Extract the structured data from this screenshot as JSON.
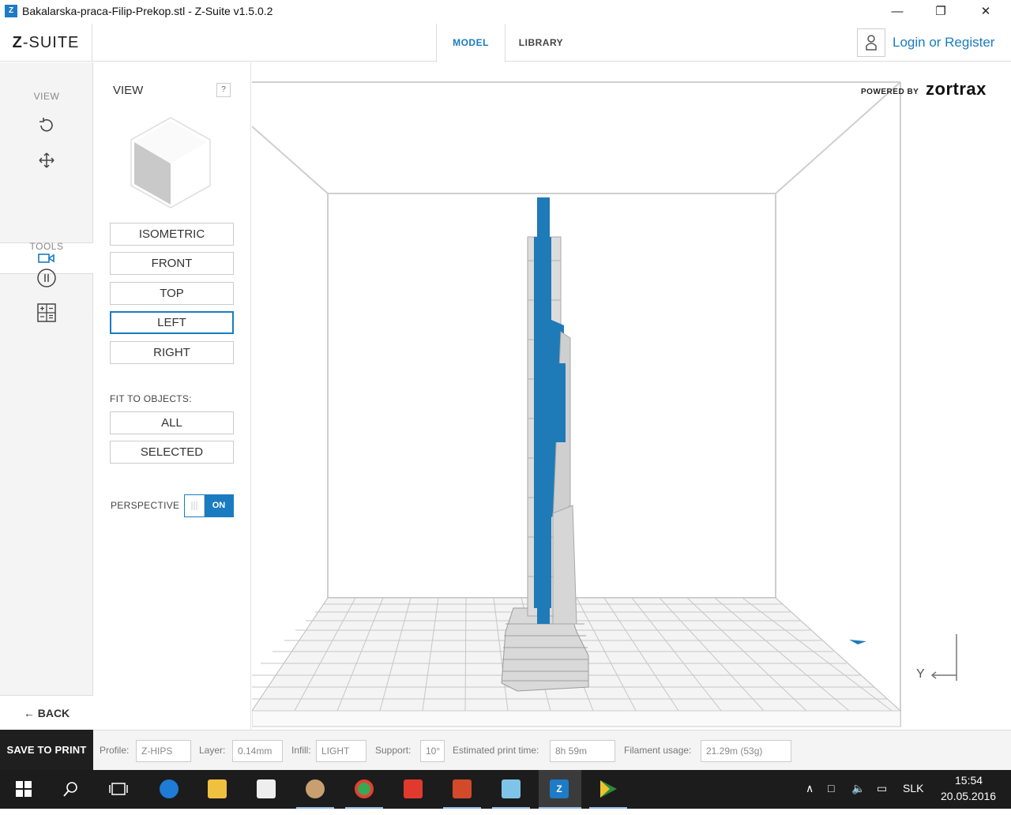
{
  "window": {
    "title": "Bakalarska-praca-Filip-Prekop.stl - Z-Suite v1.5.0.2",
    "icon_letter": "Z"
  },
  "header": {
    "logo_bold": "Z",
    "logo_rest": "-SUITE",
    "tabs": [
      {
        "label": "MODEL",
        "active": true
      },
      {
        "label": "LIBRARY",
        "active": false
      }
    ],
    "login": "Login or Register"
  },
  "sidebar": {
    "view_label": "VIEW",
    "tools_label": "TOOLS",
    "back": "BACK"
  },
  "view_panel": {
    "title": "VIEW",
    "help": "?",
    "buttons": [
      "ISOMETRIC",
      "FRONT",
      "TOP",
      "LEFT",
      "RIGHT"
    ],
    "active_button": "LEFT",
    "fit_label": "FIT TO OBJECTS:",
    "fit_buttons": [
      "ALL",
      "SELECTED"
    ],
    "perspective_label": "PERSPECTIVE",
    "perspective_state": "ON"
  },
  "viewport": {
    "powered_by": "POWERED BY",
    "brand": "zortrax",
    "axis_label": "Y"
  },
  "bottom": {
    "save": "SAVE TO PRINT",
    "profile_label": "Profile:",
    "profile": "Z-HIPS",
    "layer_label": "Layer:",
    "layer": "0.14mm",
    "infill_label": "Infill:",
    "infill": "LIGHT",
    "support_label": "Support:",
    "support": "10°",
    "time_label": "Estimated print time:",
    "time": "8h 59m",
    "filament_label": "Filament usage:",
    "filament": "21.29m (53g)"
  },
  "taskbar": {
    "lang": "SLK",
    "time": "15:54",
    "date": "20.05.2016",
    "active_app_letter": "Z"
  },
  "colors": {
    "accent": "#1a7cc0",
    "model": "#1f7ab8"
  }
}
